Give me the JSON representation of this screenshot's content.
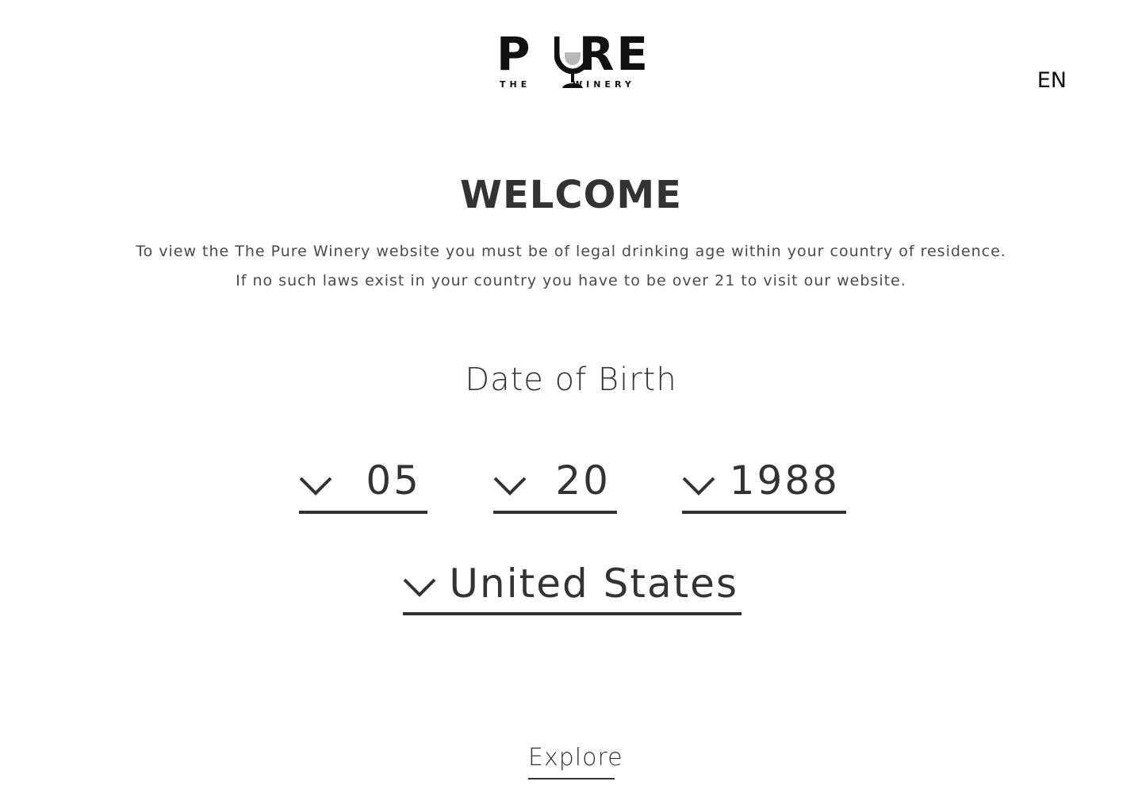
{
  "header": {
    "logo": {
      "word_left": "P",
      "word_right": "RE",
      "sub_left": "THE",
      "sub_right": "WINERY"
    },
    "language": "EN"
  },
  "welcome": {
    "title": "WELCOME",
    "line1": "To view the The Pure Winery website you must be of legal drinking age within your country of residence.",
    "line2": "If no such laws exist in your country you have to be over 21 to visit our website."
  },
  "dob": {
    "label": "Date of Birth",
    "month": "05",
    "day": "20",
    "year": "1988"
  },
  "country": {
    "value": "United States"
  },
  "cta": {
    "label": "Explore"
  },
  "colors": {
    "text": "#333333",
    "logo": "#111111",
    "glass_fill": "#b8b8b8",
    "background": "#ffffff"
  }
}
